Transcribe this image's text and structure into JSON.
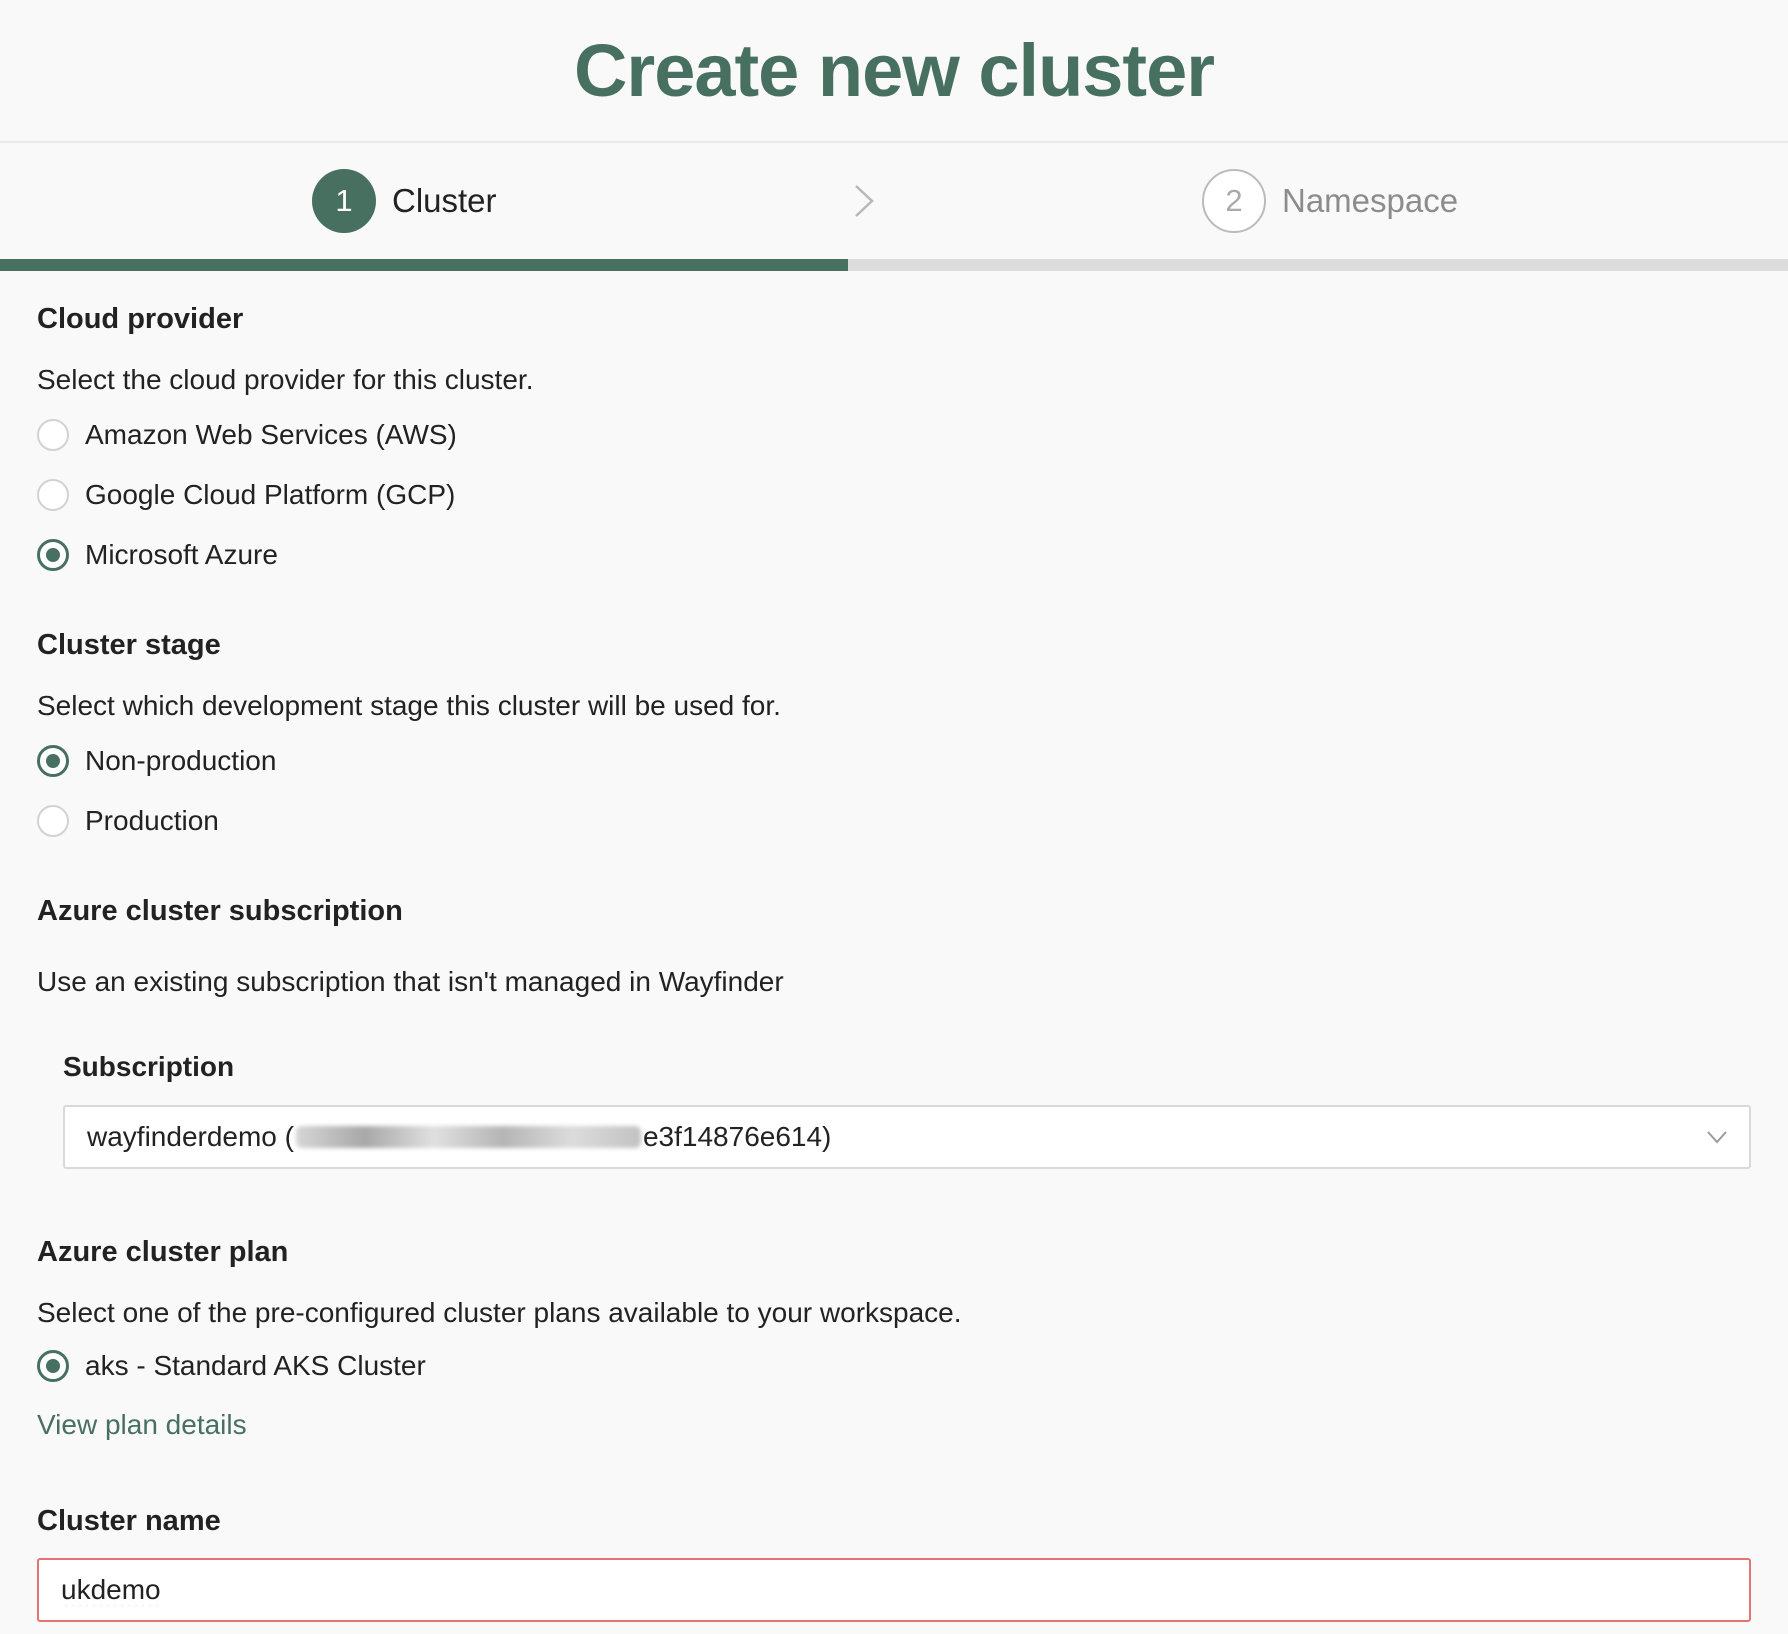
{
  "page": {
    "title": "Create new cluster"
  },
  "steps": [
    {
      "number": "1",
      "label": "Cluster",
      "state": "active"
    },
    {
      "number": "2",
      "label": "Namespace",
      "state": "inactive"
    }
  ],
  "progress": {
    "current_step": 1,
    "total_steps": 2
  },
  "cloud_provider": {
    "heading": "Cloud provider",
    "description": "Select the cloud provider for this cluster.",
    "options": [
      {
        "label": "Amazon Web Services (AWS)",
        "checked": false
      },
      {
        "label": "Google Cloud Platform (GCP)",
        "checked": false
      },
      {
        "label": "Microsoft Azure",
        "checked": true
      }
    ]
  },
  "cluster_stage": {
    "heading": "Cluster stage",
    "description": "Select which development stage this cluster will be used for.",
    "options": [
      {
        "label": "Non-production",
        "checked": true
      },
      {
        "label": "Production",
        "checked": false
      }
    ]
  },
  "subscription": {
    "heading": "Azure cluster subscription",
    "description": "Use an existing subscription that isn't managed in Wayfinder",
    "field_label": "Subscription",
    "value_prefix": "wayfinderdemo (",
    "value_suffix": "e3f14876e614)"
  },
  "cluster_plan": {
    "heading": "Azure cluster plan",
    "description": "Select one of the pre-configured cluster plans available to your workspace.",
    "options": [
      {
        "label": "aks - Standard AKS Cluster",
        "checked": true
      }
    ],
    "link": "View plan details"
  },
  "cluster_name": {
    "heading": "Cluster name",
    "value": "ukdemo"
  },
  "colors": {
    "accent": "#477061",
    "error_border": "#e57373",
    "progress_track": "#dcdcdc"
  },
  "icons": {
    "step_separator": "chevron-right-icon",
    "select_toggle": "chevron-down-icon"
  }
}
